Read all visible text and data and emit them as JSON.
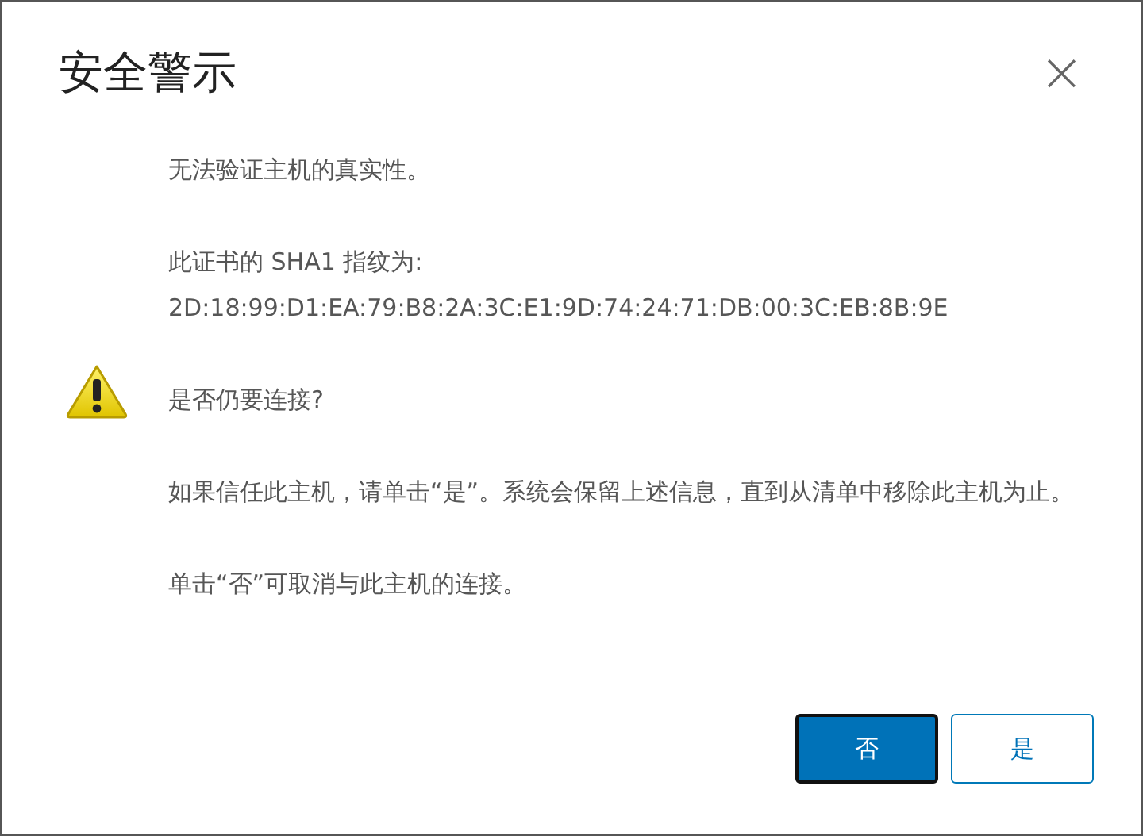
{
  "dialog": {
    "title": "安全警示",
    "close": "×"
  },
  "messages": [
    {
      "kind": "text",
      "lines": [
        "无法验证主机的真实性。"
      ]
    },
    {
      "kind": "text",
      "lines": [
        "此证书的 SHA1 指纹为:",
        "2D:18:99:D1:EA:79:B8:2A:3C:E1:9D:74:24:71:DB:00:3C:EB:8B:9E"
      ]
    },
    {
      "kind": "warning",
      "lines": [
        "是否仍要连接?"
      ]
    },
    {
      "kind": "text",
      "lines": [
        "如果信任此主机，请单击“是”。系统会保留上述信息，直到从清单中移除此主机为止。"
      ]
    },
    {
      "kind": "text",
      "lines": [
        "单击“否”可取消与此主机的连接。"
      ]
    }
  ],
  "buttons": [
    {
      "label": "否",
      "kind": "primary",
      "focused": true
    },
    {
      "label": "是",
      "kind": "secondary",
      "focused": false
    }
  ]
}
